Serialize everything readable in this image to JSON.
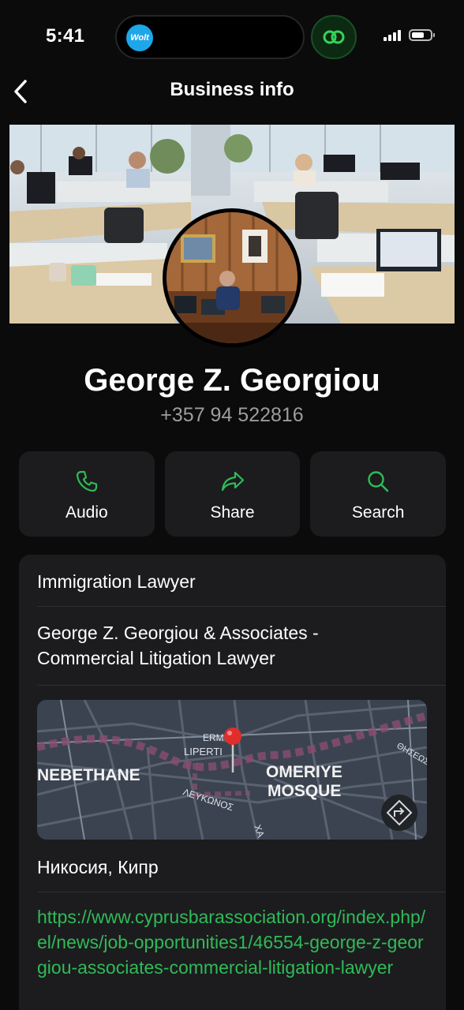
{
  "status_bar": {
    "time": "5:41",
    "wolt_label": "Wolt"
  },
  "header": {
    "title": "Business info"
  },
  "profile": {
    "name": "George Z. Georgiou",
    "phone": "+357 94 522816"
  },
  "actions": [
    {
      "label": "Audio",
      "icon": "phone-icon"
    },
    {
      "label": "Share",
      "icon": "share-arrow-icon"
    },
    {
      "label": "Search",
      "icon": "search-icon"
    }
  ],
  "info": {
    "category": "Immigration Lawyer",
    "description": "George Z. Georgiou & Associates - Commercial Litigation Lawyer",
    "address": "Никосия, Кипр",
    "website": "https://www.cyprusbarassociation.org/index.php/el/news/job-opportunities1/46554-george-z-georgiou-associates-commercial-litigation-lawyer"
  },
  "map": {
    "labels": {
      "left_district": "NEBETHANE",
      "right_landmark_line1": "OMERIYE",
      "right_landmark_line2": "MOSQUE",
      "street_ermou": "ERMOU",
      "street_liperti": "LIPERTI",
      "street_lefkonos": "ΛΕΥΚΩΝΟΣ",
      "street_theseos": "ΘΗΣΕΩΣ",
      "street_ha": "ΧΑ"
    }
  },
  "colors": {
    "accent_green": "#2fbb58",
    "background": "#0b0b0b",
    "card": "#1c1c1e",
    "secondary_text": "#9c9c9c"
  }
}
